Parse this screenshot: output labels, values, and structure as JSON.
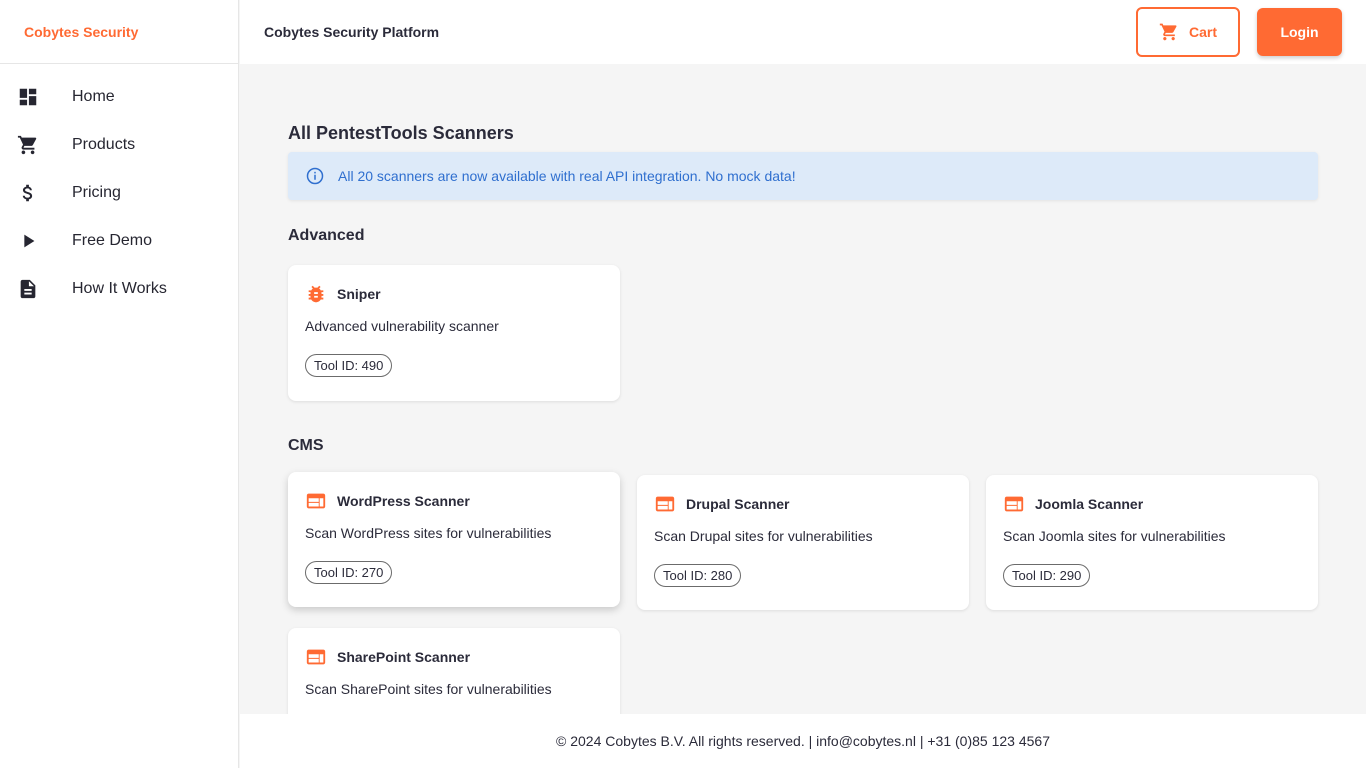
{
  "brand": {
    "name": "Cobytes Security",
    "color": "#ff6a33"
  },
  "sidebar": {
    "items": [
      {
        "label": "Home",
        "icon": "dashboard-icon"
      },
      {
        "label": "Products",
        "icon": "cart-icon"
      },
      {
        "label": "Pricing",
        "icon": "dollar-icon"
      },
      {
        "label": "Free Demo",
        "icon": "play-icon"
      },
      {
        "label": "How It Works",
        "icon": "document-icon"
      }
    ]
  },
  "header": {
    "title": "Cobytes Security Platform",
    "cart_label": "Cart",
    "login_label": "Login"
  },
  "main": {
    "title": "All PentestTools Scanners",
    "alert": "All 20 scanners are now available with real API integration. No mock data!",
    "sections": [
      {
        "title": "Advanced",
        "cards": [
          {
            "name": "Sniper",
            "desc": "Advanced vulnerability scanner",
            "tool_id": "Tool ID: 490",
            "icon": "bug-icon"
          }
        ]
      },
      {
        "title": "CMS",
        "cards": [
          {
            "name": "WordPress Scanner",
            "desc": "Scan WordPress sites for vulnerabilities",
            "tool_id": "Tool ID: 270",
            "icon": "web-icon"
          },
          {
            "name": "Drupal Scanner",
            "desc": "Scan Drupal sites for vulnerabilities",
            "tool_id": "Tool ID: 280",
            "icon": "web-icon"
          },
          {
            "name": "Joomla Scanner",
            "desc": "Scan Joomla sites for vulnerabilities",
            "tool_id": "Tool ID: 290",
            "icon": "web-icon"
          },
          {
            "name": "SharePoint Scanner",
            "desc": "Scan SharePoint sites for vulnerabilities",
            "tool_id": "",
            "icon": "web-icon"
          }
        ]
      }
    ]
  },
  "footer": {
    "text": "© 2024 Cobytes B.V. All rights reserved. | info@cobytes.nl | +31 (0)85 123 4567"
  },
  "colors": {
    "accent": "#ff6a33",
    "info_bg": "#ddeaf9",
    "info_text": "#2f6fcf"
  }
}
